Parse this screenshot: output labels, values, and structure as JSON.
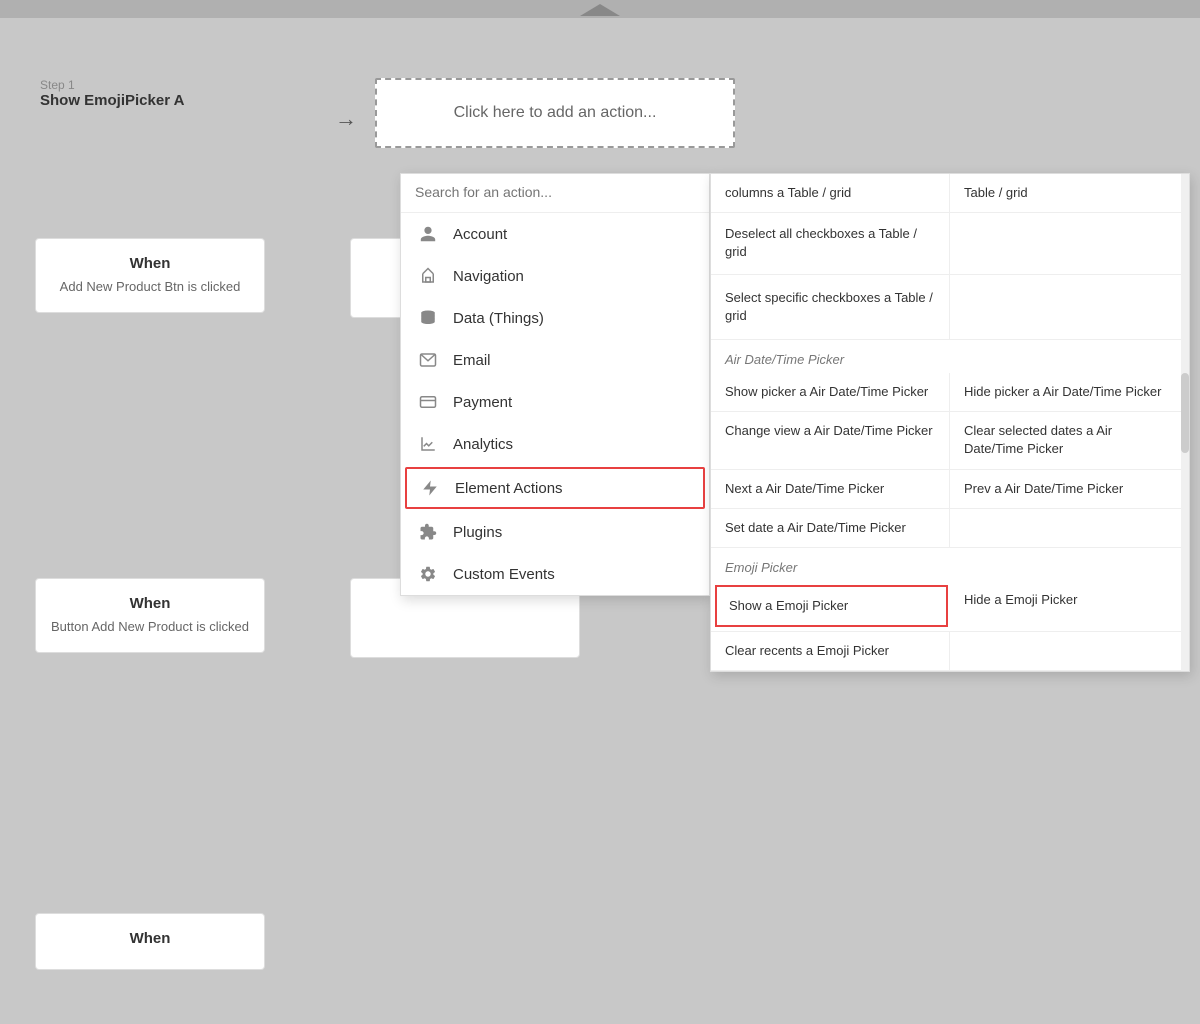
{
  "topbar": {
    "handle_label": "handle"
  },
  "workflow": {
    "step1": {
      "step_num": "Step 1",
      "step_name": "Show EmojiPicker A"
    },
    "add_action_label": "Click here to add an action...",
    "search_placeholder": "Search for an action...",
    "when_boxes": [
      {
        "title": "When",
        "description": "Add New Product Btn is clicked"
      },
      {
        "title": "When",
        "description": "Button Add New Product is clicked"
      },
      {
        "title": "When",
        "description": ""
      }
    ]
  },
  "menu": {
    "items": [
      {
        "id": "account",
        "label": "Account",
        "icon": "person"
      },
      {
        "id": "navigation",
        "label": "Navigation",
        "icon": "navigation"
      },
      {
        "id": "data",
        "label": "Data (Things)",
        "icon": "database"
      },
      {
        "id": "email",
        "label": "Email",
        "icon": "email"
      },
      {
        "id": "payment",
        "label": "Payment",
        "icon": "payment"
      },
      {
        "id": "analytics",
        "label": "Analytics",
        "icon": "analytics"
      },
      {
        "id": "element-actions",
        "label": "Element Actions",
        "icon": "element",
        "highlighted": true
      },
      {
        "id": "plugins",
        "label": "Plugins",
        "icon": "plugins"
      },
      {
        "id": "custom-events",
        "label": "Custom Events",
        "icon": "settings"
      }
    ]
  },
  "actions_panel": {
    "section1": {
      "header": "columns a Table / grid",
      "header2": "Table / grid",
      "items": [
        {
          "label": "Deselect all checkboxes a Table / grid",
          "highlighted": false
        }
      ]
    },
    "section2": {
      "items": [
        {
          "label": "Select specific checkboxes a Table / grid",
          "col": 1
        }
      ]
    },
    "section3": {
      "header": "Air Date/Time Picker",
      "items": [
        {
          "label": "Show picker a Air Date/Time Picker",
          "col": 1
        },
        {
          "label": "Hide picker a Air Date/Time Picker",
          "col": 2
        },
        {
          "label": "Change view a Air Date/Time Picker",
          "col": 1
        },
        {
          "label": "Clear selected dates a Air Date/Time Picker",
          "col": 2
        },
        {
          "label": "Next a Air Date/Time Picker",
          "col": 1
        },
        {
          "label": "Prev a Air Date/Time Picker",
          "col": 2
        },
        {
          "label": "Set date a Air Date/Time Picker",
          "col": 1
        }
      ]
    },
    "section4": {
      "header": "Emoji Picker",
      "items": [
        {
          "label": "Show a Emoji Picker",
          "col": 1,
          "highlighted": true
        },
        {
          "label": "Hide a Emoji Picker",
          "col": 2,
          "highlighted": false
        },
        {
          "label": "Clear recents a Emoji Picker",
          "col": 1
        }
      ]
    }
  }
}
